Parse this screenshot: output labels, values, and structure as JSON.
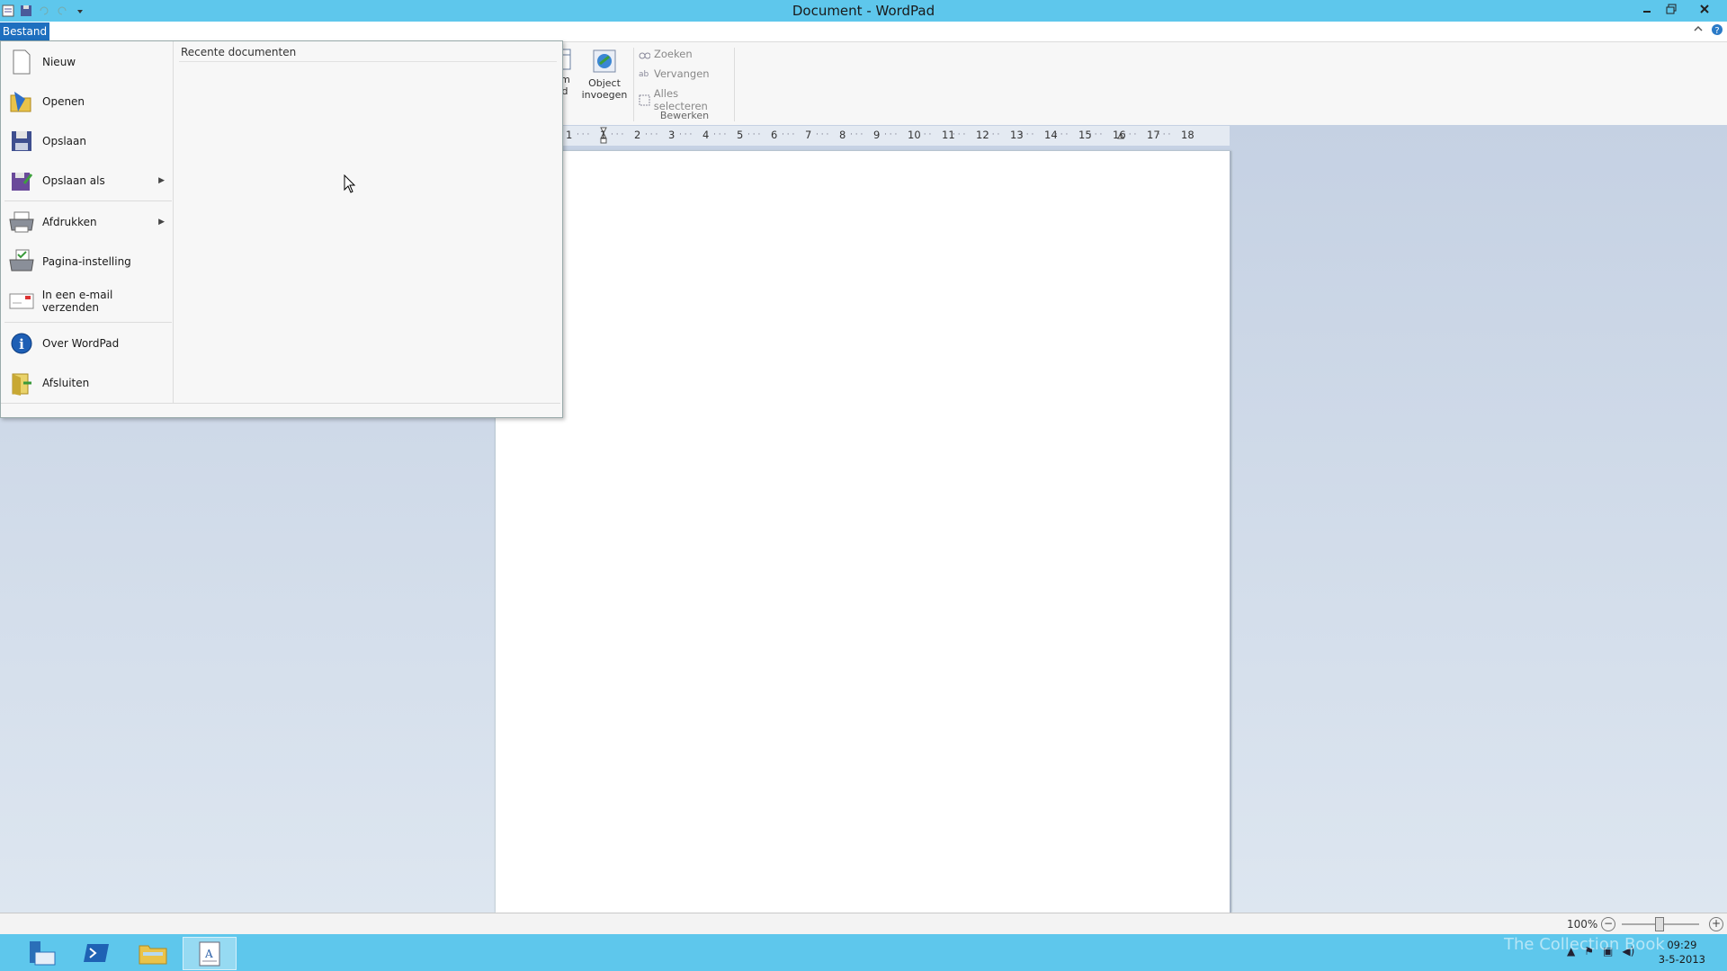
{
  "window": {
    "title": "Document - WordPad"
  },
  "file_tab": {
    "label": "Bestand"
  },
  "file_menu": {
    "items": [
      {
        "label": "Nieuw",
        "icon": "new-document-icon",
        "submenu": false
      },
      {
        "label": "Openen",
        "icon": "open-folder-icon",
        "submenu": false
      },
      {
        "label": "Opslaan",
        "icon": "save-disk-icon",
        "submenu": false
      },
      {
        "label": "Opslaan als",
        "icon": "save-as-icon",
        "submenu": true
      },
      {
        "label": "Afdrukken",
        "icon": "printer-icon",
        "submenu": true
      },
      {
        "label": "Pagina-instelling",
        "icon": "page-setup-icon",
        "submenu": false
      },
      {
        "label": "In een e-mail verzenden",
        "icon": "email-icon",
        "submenu": false
      },
      {
        "label": "Over WordPad",
        "icon": "info-icon",
        "submenu": false
      },
      {
        "label": "Afsluiten",
        "icon": "exit-icon",
        "submenu": false
      }
    ],
    "recent_title": "Recente documenten"
  },
  "ribbon": {
    "insert_group": {
      "datetime_partial_line1": "um",
      "datetime_partial_line2": "ijd",
      "object_label_line1": "Object",
      "object_label_line2": "invoegen"
    },
    "edit_group": {
      "find": "Zoeken",
      "replace": "Vervangen",
      "select_all": "Alles selecteren",
      "group_label": "Bewerken"
    }
  },
  "ruler": {
    "ticks": [
      "1",
      "1",
      "2",
      "3",
      "4",
      "5",
      "6",
      "7",
      "8",
      "9",
      "10",
      "11",
      "12",
      "13",
      "14",
      "15",
      "16",
      "17",
      "18"
    ]
  },
  "statusbar": {
    "zoom": "100%"
  },
  "taskbar": {
    "time": "09:29",
    "date": "3-5-2013",
    "watermark": "The Collection Book"
  },
  "colors": {
    "chrome": "#5ec7ec",
    "file_tab": "#1e6fbf",
    "workspace": "#c5d1e3"
  }
}
